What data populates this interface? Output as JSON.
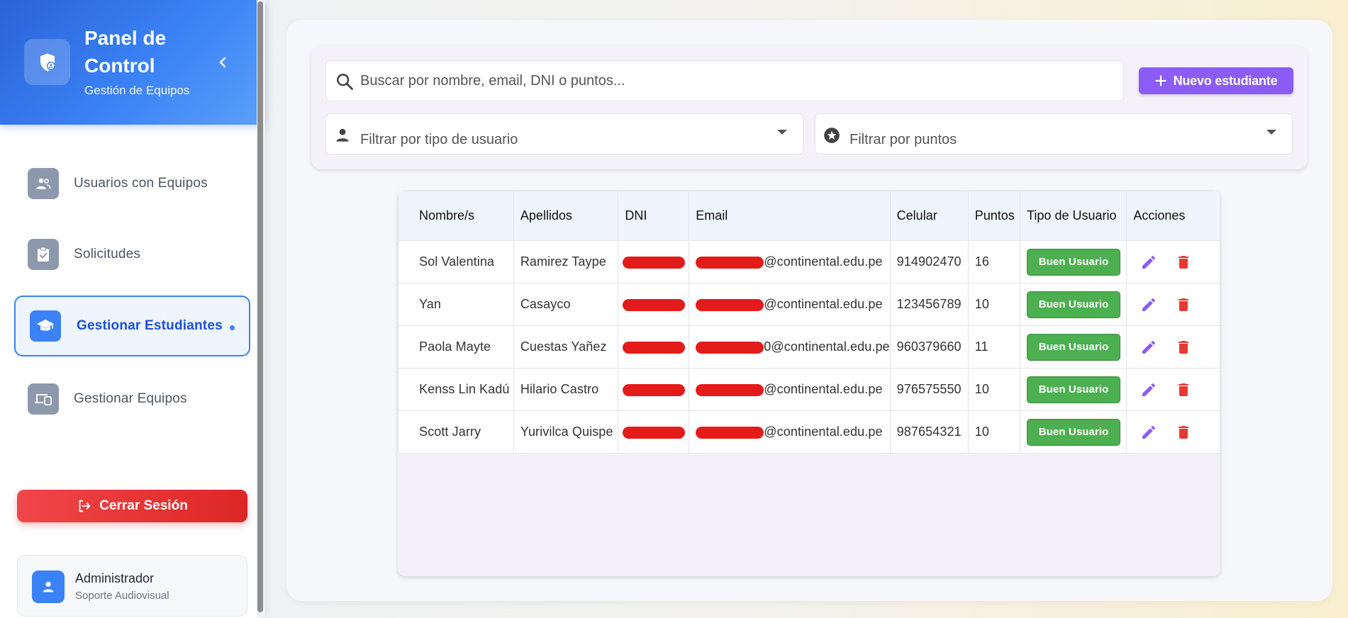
{
  "sidebar": {
    "brand_title": "Panel de Control",
    "brand_subtitle": "Gestión de Equipos",
    "nav": [
      {
        "label": "Usuarios con Equipos",
        "icon": "users-icon",
        "active": false
      },
      {
        "label": "Solicitudes",
        "icon": "clipboard-check-icon",
        "active": false
      },
      {
        "label": "Gestionar Estudiantes",
        "icon": "graduation-cap-icon",
        "active": true
      },
      {
        "label": "Gestionar Equipos",
        "icon": "devices-icon",
        "active": false
      }
    ],
    "logout_label": "Cerrar Sesión",
    "user": {
      "name": "Administrador",
      "role": "Soporte Audiovisual"
    }
  },
  "toolbar": {
    "search_placeholder": "Buscar por nombre, email, DNI o puntos...",
    "new_button": "Nuevo estudiante",
    "filter_type_placeholder": "Filtrar por tipo de usuario",
    "filter_points_placeholder": "Filtrar por puntos"
  },
  "table": {
    "headers": [
      "Nombre/s",
      "Apellidos",
      "DNI",
      "Email",
      "Celular",
      "Puntos",
      "Tipo de Usuario",
      "Acciones"
    ],
    "rows": [
      {
        "nombre": "Sol Valentina",
        "apellidos": "Ramirez Taype",
        "email_domain": "@continental.edu.pe",
        "celular": "914902470",
        "puntos": "16",
        "tipo": "Buen Usuario"
      },
      {
        "nombre": "Yan",
        "apellidos": "Casayco",
        "email_domain": "@continental.edu.pe",
        "celular": "123456789",
        "puntos": "10",
        "tipo": "Buen Usuario"
      },
      {
        "nombre": "Paola Mayte",
        "apellidos": "Cuestas Yañez",
        "email_domain": "0@continental.edu.pe",
        "celular": "960379660",
        "puntos": "11",
        "tipo": "Buen Usuario"
      },
      {
        "nombre": "Kenss Lin Kadú",
        "apellidos": "Hilario Castro",
        "email_domain": "@continental.edu.pe",
        "celular": "976575550",
        "puntos": "10",
        "tipo": "Buen Usuario"
      },
      {
        "nombre": "Scott Jarry",
        "apellidos": "Yurivilca Quispe",
        "email_domain": "@continental.edu.pe",
        "celular": "987654321",
        "puntos": "10",
        "tipo": "Buen Usuario"
      }
    ]
  },
  "colors": {
    "primary": "#3b82f6",
    "accent_purple": "#8b5cf6",
    "danger": "#dc2626",
    "success": "#4caf50",
    "redaction": "#e31b1b"
  }
}
